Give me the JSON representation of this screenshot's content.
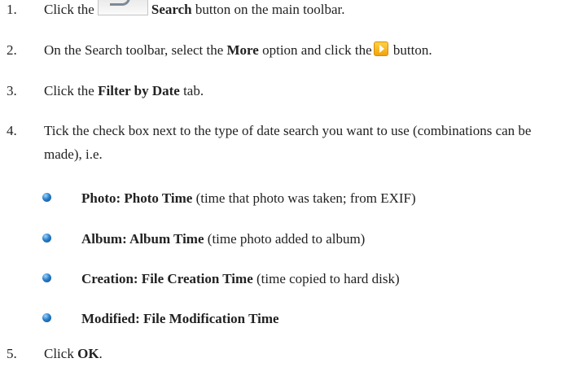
{
  "steps": [
    {
      "number": "1.",
      "before": "Click the",
      "bold": "Search",
      "after": " button on the main toolbar."
    },
    {
      "number": "2.",
      "before": "On the Search toolbar, select the ",
      "bold": "More",
      "middle": " option and click the",
      "after": " button."
    },
    {
      "number": "3.",
      "before": "Click the ",
      "bold": "Filter by Date",
      "after": " tab."
    },
    {
      "number": "4.",
      "text": "Tick the check box next to the type of date search you want to use (combinations can be made), i.e."
    },
    {
      "number": "5.",
      "before": "Click ",
      "bold": "OK",
      "after": "."
    }
  ],
  "bullets": [
    {
      "bold": "Photo: Photo Time",
      "rest": " (time that photo was taken; from EXIF)"
    },
    {
      "bold": "Album: Album Time",
      "rest": " (time photo added to album)"
    },
    {
      "bold": "Creation: File Creation Time",
      "rest": " (time copied to hard disk)"
    },
    {
      "bold": "Modified: File Modification Time",
      "rest": ""
    }
  ],
  "icons": {
    "search_button": "search-toolbar-icon",
    "go_button": "orange-play-icon",
    "bullet": "blue-ball-bullet-icon"
  },
  "colors": {
    "text": "#222222",
    "go_button": "#f0a30a",
    "bullet": "#2a7fc9"
  }
}
